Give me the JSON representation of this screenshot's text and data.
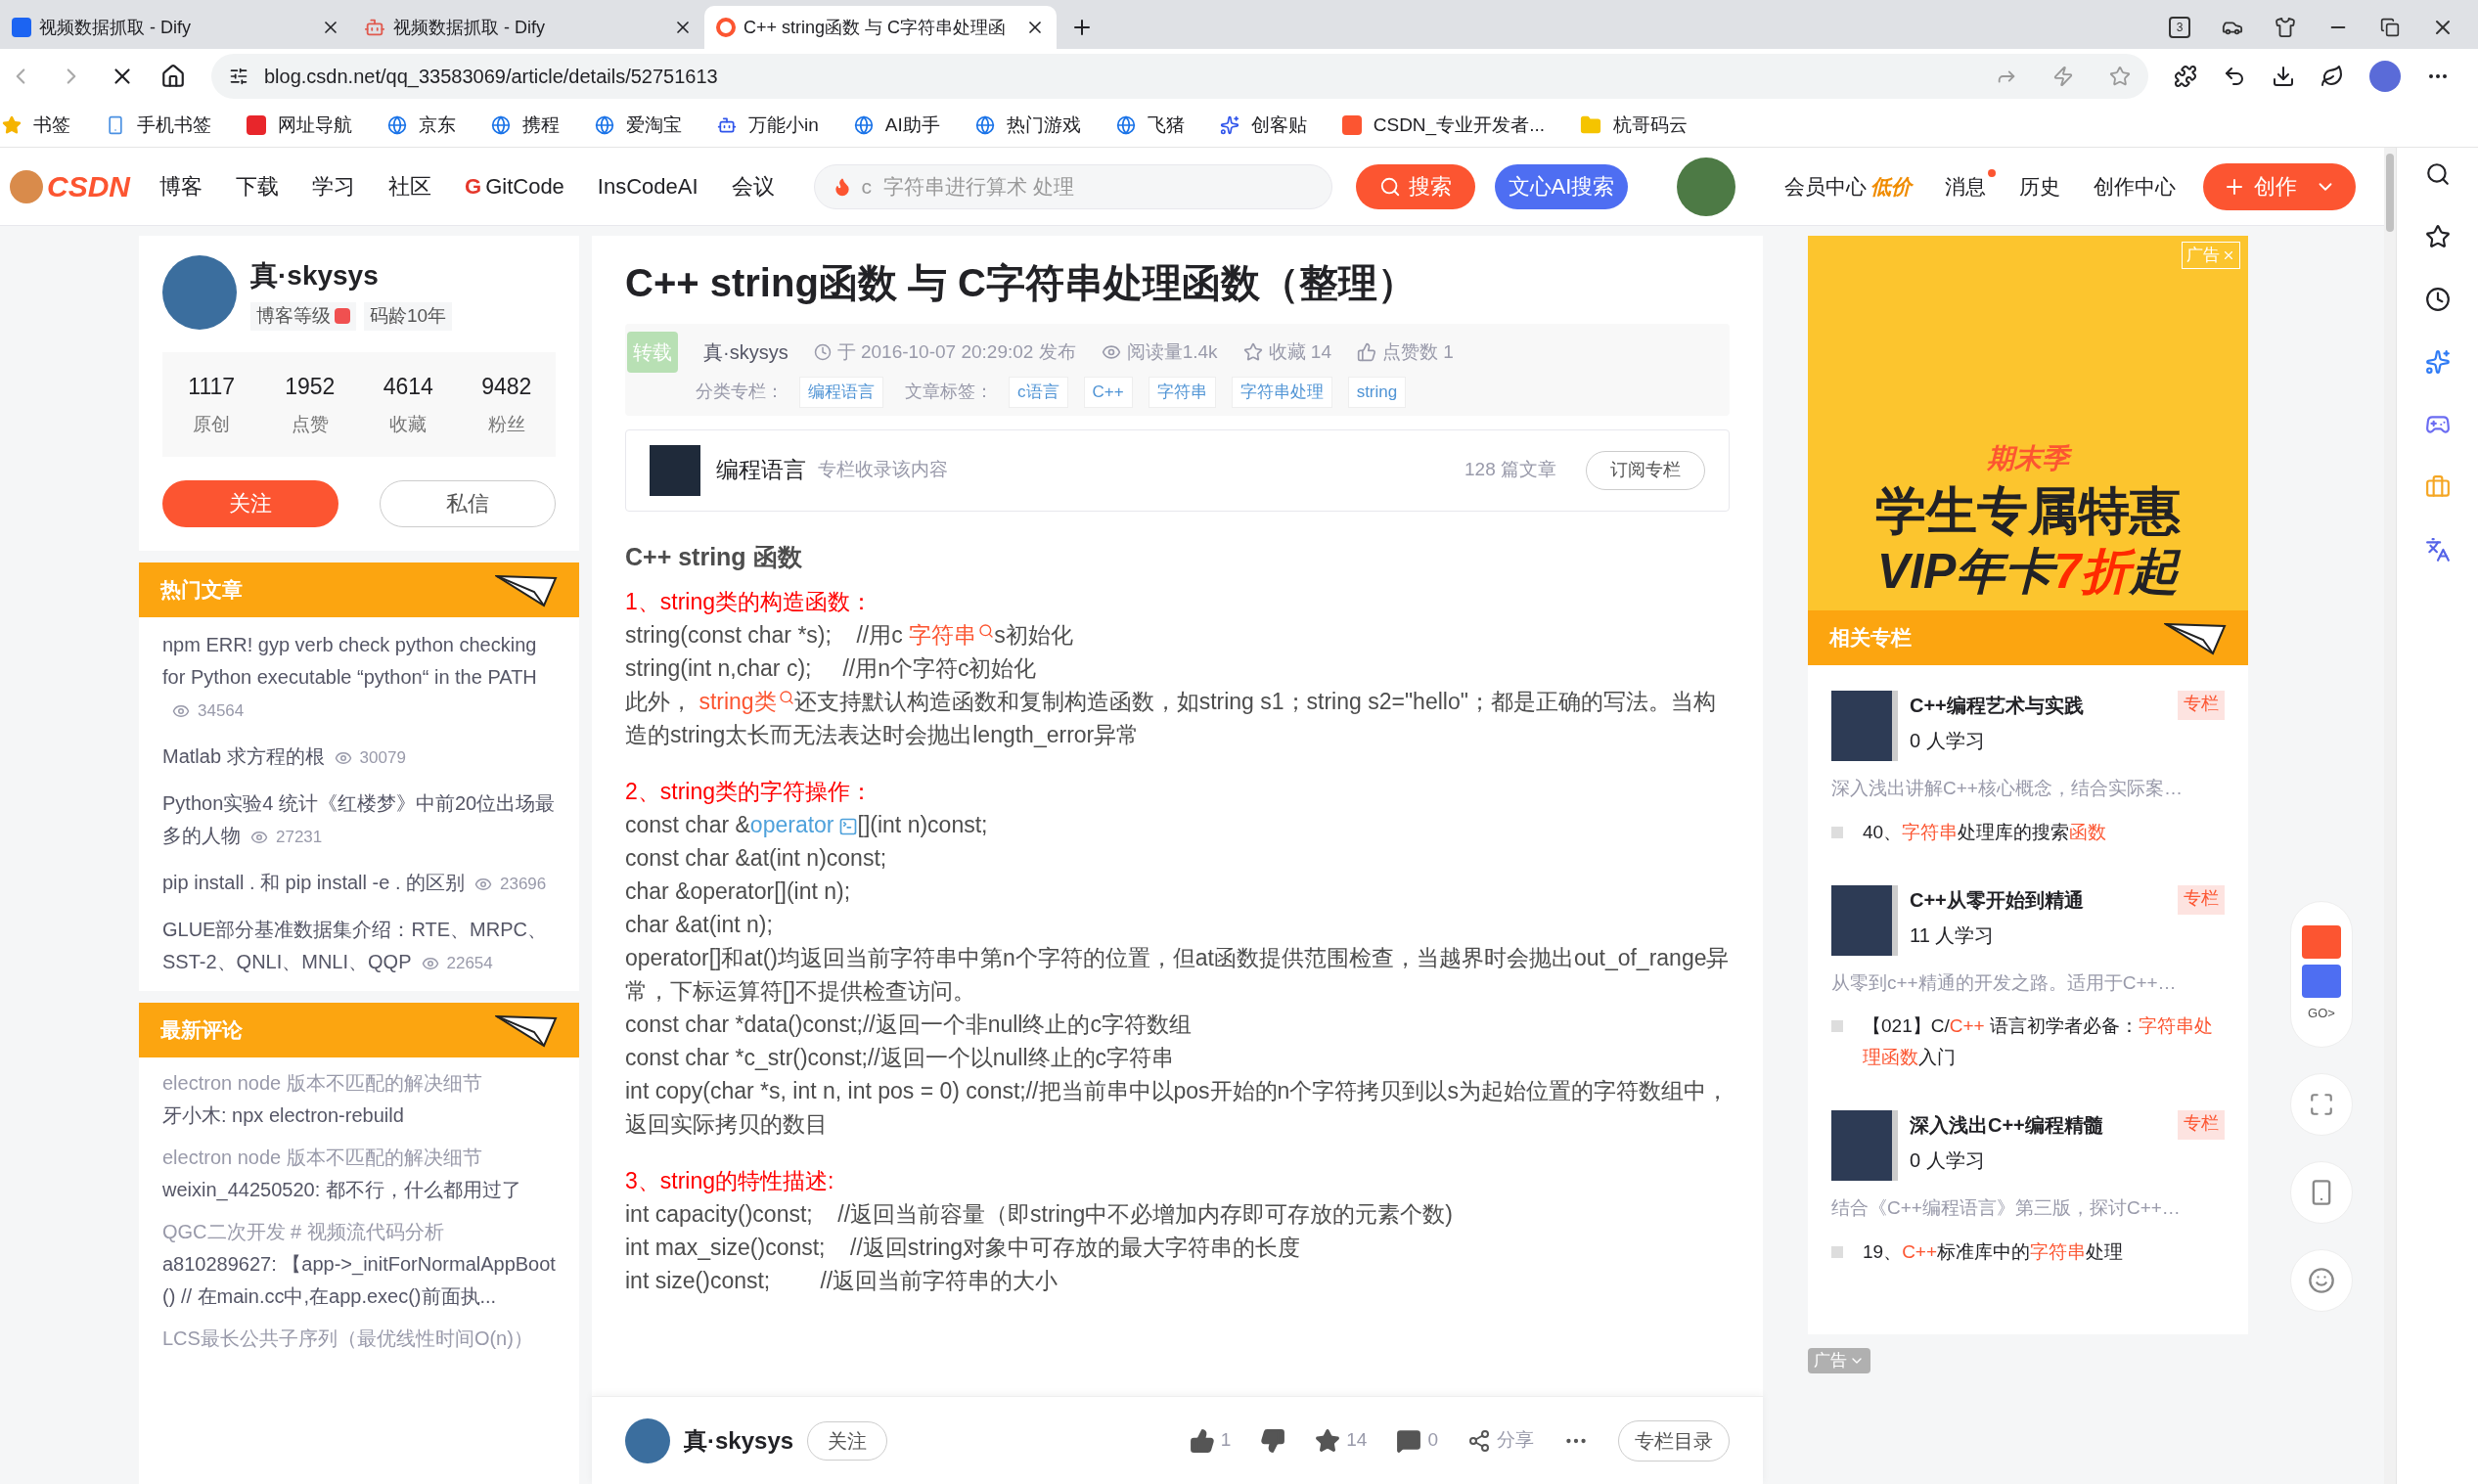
{
  "browser": {
    "tabs": [
      {
        "title": "视频数据抓取 - Dify",
        "kind": "dify",
        "selected": false
      },
      {
        "title": "视频数据抓取 - Dify",
        "kind": "bot",
        "selected": false
      },
      {
        "title": "C++ string函数 与 C字符串处理函",
        "kind": "csdn",
        "selected": true
      }
    ],
    "tab_count": "3",
    "url": "blog.csdn.net/qq_33583069/article/details/52751613",
    "bookmarks": [
      {
        "label": "书签",
        "kind": "star"
      },
      {
        "label": "手机书签",
        "kind": "phone"
      },
      {
        "label": "网址导航",
        "kind": "nav"
      },
      {
        "label": "京东",
        "kind": "edge"
      },
      {
        "label": "携程",
        "kind": "edge"
      },
      {
        "label": "爱淘宝",
        "kind": "edge"
      },
      {
        "label": "万能小in",
        "kind": "bot"
      },
      {
        "label": "AI助手",
        "kind": "edge"
      },
      {
        "label": "热门游戏",
        "kind": "edge"
      },
      {
        "label": "飞猪",
        "kind": "edge"
      },
      {
        "label": "创客贴",
        "kind": "blob"
      },
      {
        "label": "CSDN_专业开发者...",
        "kind": "csdn"
      },
      {
        "label": "杭哥码云",
        "kind": "folder"
      }
    ]
  },
  "nav": {
    "logo": "CSDN",
    "items": [
      {
        "label": "博客",
        "kind": "plain"
      },
      {
        "label": "下载",
        "kind": "plain"
      },
      {
        "label": "学习",
        "kind": "plain"
      },
      {
        "label": "社区",
        "kind": "plain"
      },
      {
        "label": "GitCode",
        "kind": "gitcode",
        "mark": "G"
      },
      {
        "label": "InsCodeAI",
        "kind": "plain"
      },
      {
        "label": "会议",
        "kind": "plain"
      }
    ],
    "search_placeholder": "c  字符串进行算术 处理",
    "search_button": "搜索",
    "ai_search": "文心AI搜索",
    "member": {
      "label": "会员中心",
      "badge": "低价"
    },
    "messages": {
      "label": "消息",
      "has_new": true
    },
    "history": "历史",
    "creator": "创作中心",
    "create": "创作"
  },
  "profile": {
    "name": "真·skysys",
    "level_label": "博客等级",
    "age": "码龄10年",
    "stats": [
      {
        "value": "1117",
        "label": "原创"
      },
      {
        "value": "1952",
        "label": "点赞"
      },
      {
        "value": "4614",
        "label": "收藏"
      },
      {
        "value": "9482",
        "label": "粉丝"
      }
    ],
    "follow": "关注",
    "message": "私信"
  },
  "hot": {
    "title": "热门文章",
    "items": [
      {
        "title": "npm ERR! gyp verb check python checking for Python executable “python“ in the PATH",
        "views": "34564"
      },
      {
        "title": "Matlab 求方程的根",
        "views": "30079"
      },
      {
        "title": "Python实验4 统计《红楼梦》中前20位出场最多的人物",
        "views": "27231"
      },
      {
        "title": "pip install . 和 pip install -e . 的区别",
        "views": "23696"
      },
      {
        "title": "GLUE部分基准数据集介绍：RTE、MRPC、SST-2、QNLI、MNLI、QQP",
        "views": "22654"
      }
    ]
  },
  "comments": {
    "title": "最新评论",
    "items": [
      {
        "article": "electron node 版本不匹配的解决细节",
        "comment": "牙小木: npx electron-rebuild"
      },
      {
        "article": "electron node 版本不匹配的解决细节",
        "comment": "weixin_44250520: 都不行，什么都用过了"
      },
      {
        "article": "QGC二次开发 # 视频流代码分析",
        "comment": "a810289627: 【app->_initForNormalAppBoot() // 在main.cc中,在app.exec()前面执..."
      },
      {
        "article": "LCS最长公共子序列（最优线性时间O(n)）"
      }
    ]
  },
  "article": {
    "title": "C++ string函数 与 C字符串处理函数（整理）",
    "repost": "转载",
    "author": "真·skysys",
    "date": "于 2016-10-07 20:29:02 发布",
    "reads": "阅读量1.4k",
    "favorites": "收藏 14",
    "likes": "点赞数 1",
    "category_label": "分类专栏：",
    "categories": [
      "编程语言"
    ],
    "tags_label": "文章标签：",
    "tags": [
      "c语言",
      "C++",
      "字符串",
      "字符串处理",
      "string"
    ],
    "column": {
      "name": "编程语言",
      "note": "专栏收录该内容",
      "count": "128 篇文章",
      "subscribe": "订阅专栏"
    },
    "heading": "C++ string 函数",
    "sections": [
      {
        "title": "1、string类的构造函数：",
        "lines": [
          [
            {
              "text": "string(const char *s);    //用c ",
              "kind": "text"
            },
            {
              "text": "字符串",
              "kind": "keyword"
            },
            {
              "text": "s初始化",
              "kind": "text"
            }
          ],
          [
            {
              "text": "string(int n,char c);     //用n个字符c初始化",
              "kind": "text"
            }
          ],
          [
            {
              "text": "此外， ",
              "kind": "text"
            },
            {
              "text": "string类",
              "kind": "keyword"
            },
            {
              "text": "还支持默认构造函数和复制构造函数，如string s1；string s2=\"hello\"；都是正确的写法。当构造的string太长而无法表达时会抛出length_error异常",
              "kind": "text"
            }
          ]
        ]
      },
      {
        "title": "2、string类的字符操作：",
        "lines": [
          [
            {
              "text": "const char &",
              "kind": "text"
            },
            {
              "text": "operator",
              "kind": "link"
            },
            {
              "text": "[](int n)const;",
              "kind": "text"
            }
          ],
          [
            {
              "text": "const char &at(int n)const;",
              "kind": "text"
            }
          ],
          [
            {
              "text": "char &operator[](int n);",
              "kind": "text"
            }
          ],
          [
            {
              "text": "char &at(int n);",
              "kind": "text"
            }
          ],
          [
            {
              "text": "operator[]和at()均返回当前字符串中第n个字符的位置，但at函数提供范围检查，当越界时会抛出out_of_range异常，下标运算符[]不提供检查访问。",
              "kind": "text"
            }
          ],
          [
            {
              "text": "const char *data()const;//返回一个非null终止的c字符数组",
              "kind": "text"
            }
          ],
          [
            {
              "text": "const char *c_str()const;//返回一个以null终止的c字符串",
              "kind": "text"
            }
          ],
          [
            {
              "text": "int copy(char *s, int n, int pos = 0) const;//把当前串中以pos开始的n个字符拷贝到以s为起始位置的字符数组中，返回实际拷贝的数目",
              "kind": "text"
            }
          ]
        ]
      },
      {
        "title": "3、string的特性描述:",
        "lines": [
          [
            {
              "text": "int capacity()const;    //返回当前容量（即string中不必增加内存即可存放的元素个数)",
              "kind": "text"
            }
          ],
          [
            {
              "text": "int max_size()const;    //返回string对象中可存放的最大字符串的长度",
              "kind": "text"
            }
          ],
          [
            {
              "text": "int size()const;        //返回当前字符串的大小",
              "kind": "text"
            }
          ]
        ]
      }
    ]
  },
  "bottom_bar": {
    "author": "真·skysys",
    "follow": "关注",
    "likes": "1",
    "favorites": "14",
    "comments": "0",
    "share": "分享",
    "toc": "专栏目录"
  },
  "ad": {
    "label": "广告",
    "kicker": "期末季",
    "headline": "学生专属特惠",
    "offer": [
      {
        "text": "VIP年卡",
        "kind": "text"
      },
      {
        "text": "7折",
        "kind": "hl"
      },
      {
        "text": "起",
        "kind": "text"
      }
    ]
  },
  "related": {
    "title": "相关专栏",
    "items": [
      {
        "name": "C++编程艺术与实践",
        "learners": "0 人学习",
        "tag": "专栏",
        "desc": "深入浅出讲解C++核心概念，结合实际案…",
        "article": [
          {
            "text": "40、",
            "kind": "text"
          },
          {
            "text": "字符串",
            "kind": "hl"
          },
          {
            "text": "处理库的搜索",
            "kind": "text"
          },
          {
            "text": "函数",
            "kind": "hl"
          }
        ]
      },
      {
        "name": "C++从零开始到精通",
        "learners": "11 人学习",
        "tag": "专栏",
        "desc": "从零到c++精通的开发之路。适用于C++…",
        "article": [
          {
            "text": "【021】C/",
            "kind": "text"
          },
          {
            "text": "C++",
            "kind": "hl"
          },
          {
            "text": " 语言初学者必备：",
            "kind": "text"
          },
          {
            "text": "字符串处理函数",
            "kind": "hl"
          },
          {
            "text": "入门",
            "kind": "text"
          }
        ]
      },
      {
        "name": "深入浅出C++编程精髓",
        "learners": "0 人学习",
        "tag": "专栏",
        "desc": "结合《C++编程语言》第三版，探讨C++…",
        "article": [
          {
            "text": "19、",
            "kind": "text"
          },
          {
            "text": "C++",
            "kind": "hl"
          },
          {
            "text": "标准库中的",
            "kind": "text"
          },
          {
            "text": "字符串",
            "kind": "hl"
          },
          {
            "text": "处理",
            "kind": "text"
          }
        ]
      }
    ]
  },
  "bottom_ad_label": "广告",
  "float_go": "GO>"
}
